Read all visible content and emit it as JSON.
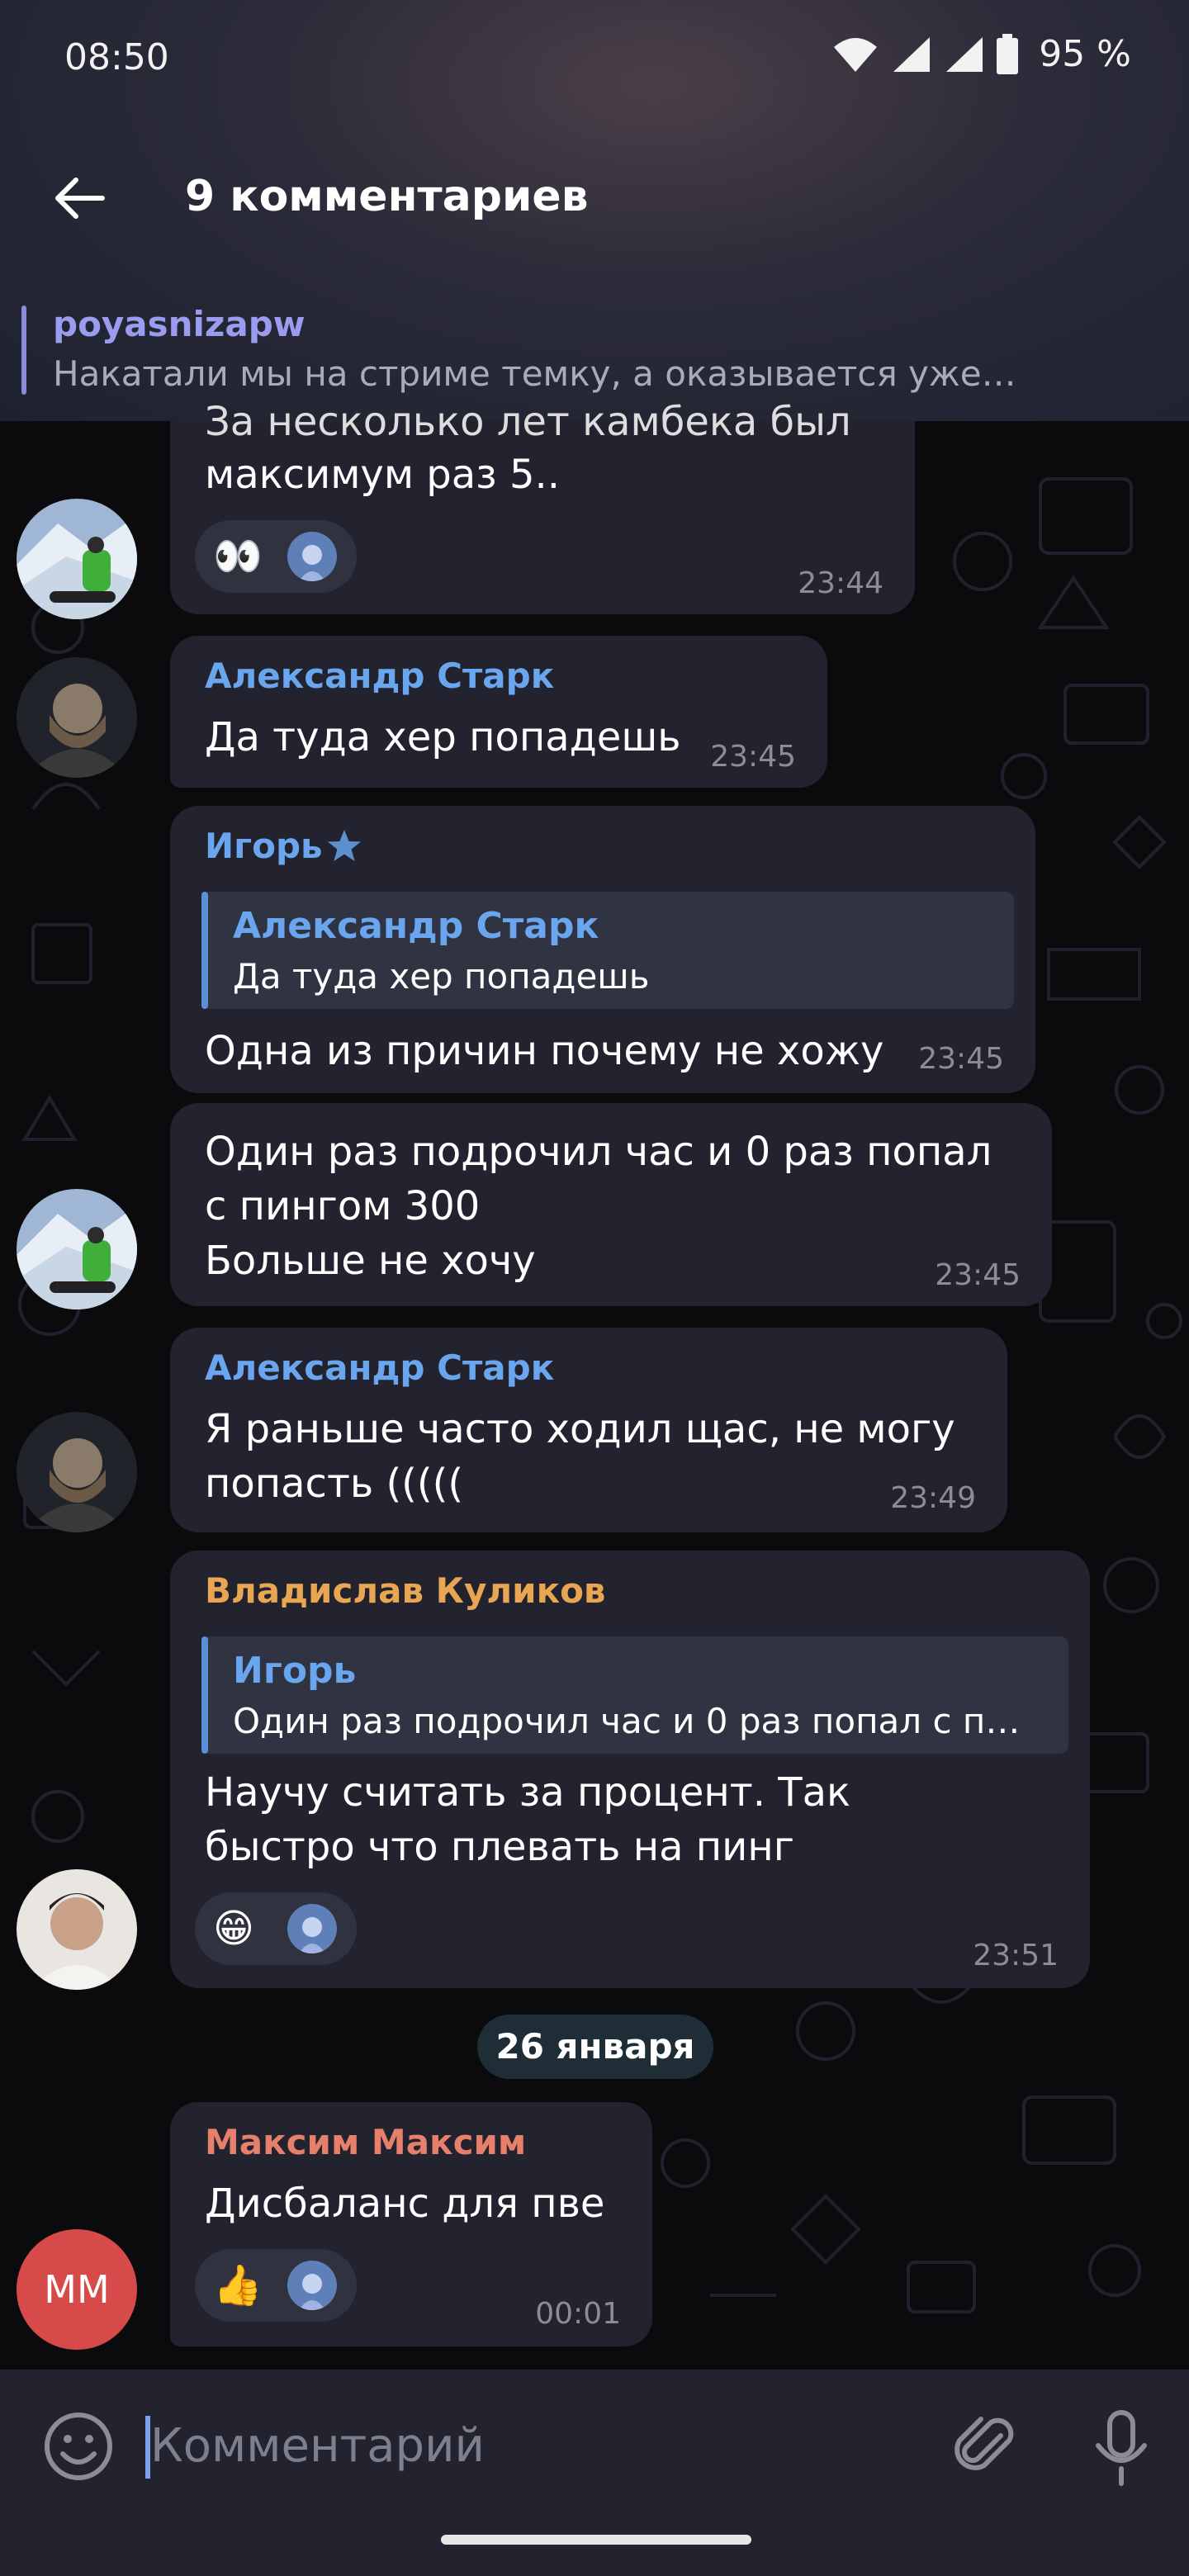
{
  "status_bar": {
    "time": "08:50",
    "battery": "95 %"
  },
  "header": {
    "title": "9 комментариев"
  },
  "pinned": {
    "name": "poyasnizapw",
    "text": "Накатали мы на стриме темку, а оказывается уже…"
  },
  "messages": [
    {
      "lines": [
        "За несколько лет камбека был",
        "максимум раз 5.."
      ],
      "time": "23:44",
      "reaction_emoji": "👀"
    },
    {
      "sender": "Александр Старк",
      "lines": [
        "Да туда хер попадешь"
      ],
      "time": "23:45"
    },
    {
      "sender": "Игорь",
      "reply": {
        "name": "Александр Старк",
        "text": "Да туда хер попадешь"
      },
      "lines": [
        "Одна из причин почему не хожу"
      ],
      "time": "23:45"
    },
    {
      "lines": [
        "Один раз подрочил час и 0 раз попал",
        "с пингом 300",
        "Больше не хочу"
      ],
      "time": "23:45"
    },
    {
      "sender": "Александр Старк",
      "lines": [
        "Я раньше часто ходил щас, не могу",
        "попасть ((((("
      ],
      "time": "23:49"
    },
    {
      "sender": "Владислав Куликов",
      "reply": {
        "name": "Игорь",
        "text": "Один раз подрочил час и 0 раз попал с п…"
      },
      "lines": [
        "Научу считать за процент. Так",
        "быстро что плевать на пинг"
      ],
      "time": "23:51",
      "reaction_emoji": "😁"
    },
    {
      "sender": "Максим Максим",
      "lines": [
        "Дисбаланс для пве"
      ],
      "time": "00:01",
      "reaction_emoji": "👍",
      "avatar_initials": "ММ"
    }
  ],
  "date_divider": "26 января",
  "composer": {
    "placeholder": "Комментарий"
  },
  "colors": {
    "sender_blue": "#6aa6ef",
    "sender_orange": "#e8a552",
    "sender_red": "#e7806a",
    "bubble": "#22232e",
    "avatar_mm": "#d64a4a"
  },
  "icons": [
    "wifi-icon",
    "signal-icon",
    "battery-icon",
    "back-arrow-icon",
    "star-icon",
    "emoji-icon",
    "attach-icon",
    "mic-icon"
  ]
}
